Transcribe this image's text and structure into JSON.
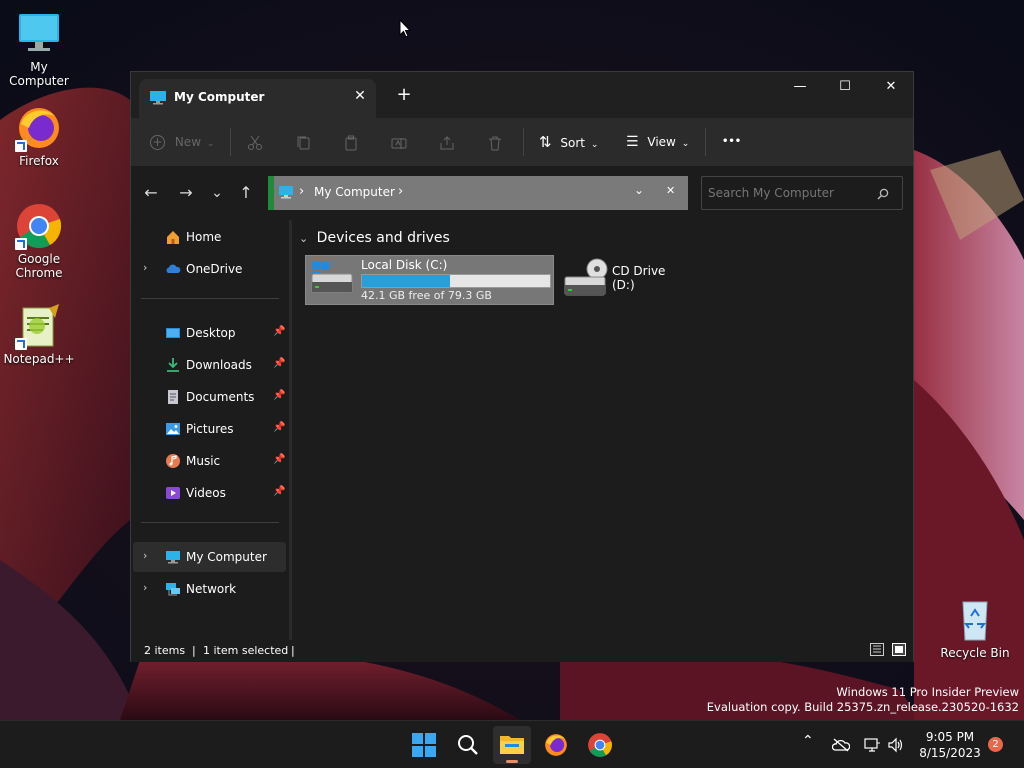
{
  "desktop": {
    "icons": [
      {
        "label": "My Computer"
      },
      {
        "label": "Firefox"
      },
      {
        "label": "Google Chrome"
      },
      {
        "label": "Notepad++"
      },
      {
        "label": "Recycle Bin"
      }
    ],
    "watermark": {
      "line1": "Windows 11 Pro Insider Preview",
      "line2": "Evaluation copy. Build 25375.zn_release.230520-1632"
    }
  },
  "window": {
    "tab_title": "My Computer",
    "tab_close_glyph": "✕",
    "new_tab_glyph": "+",
    "controls": {
      "minimize": "—",
      "maximize": "☐",
      "close": "✕"
    }
  },
  "toolbar": {
    "new_label": "New",
    "sort_label": "Sort",
    "view_label": "View",
    "more_glyph": "•••",
    "disabled_icons": [
      "cut-icon",
      "copy-icon",
      "paste-icon",
      "rename-icon",
      "share-icon",
      "delete-icon"
    ]
  },
  "navigation": {
    "back": "←",
    "forward": "→",
    "recent": "⌄",
    "up": "↑",
    "address": {
      "crumb_sep": "›",
      "location": "My Computer"
    },
    "search_placeholder": "Search My Computer"
  },
  "sidebar": {
    "top": [
      {
        "label": "Home",
        "icon": "home-icon"
      },
      {
        "label": "OneDrive",
        "icon": "cloud-icon"
      }
    ],
    "quick_access": [
      {
        "label": "Desktop",
        "icon": "desktop-icon"
      },
      {
        "label": "Downloads",
        "icon": "download-icon"
      },
      {
        "label": "Documents",
        "icon": "documents-icon"
      },
      {
        "label": "Pictures",
        "icon": "pictures-icon"
      },
      {
        "label": "Music",
        "icon": "music-icon"
      },
      {
        "label": "Videos",
        "icon": "videos-icon"
      }
    ],
    "bottom": [
      {
        "label": "My Computer",
        "icon": "computer-icon",
        "selected": true
      },
      {
        "label": "Network",
        "icon": "network-icon"
      }
    ]
  },
  "content": {
    "group_header": "Devices and drives",
    "drives": [
      {
        "name": "Local Disk (C:)",
        "free_text": "42.1 GB free of 79.3 GB",
        "used_fraction": 0.469,
        "selected": true
      },
      {
        "name": "CD Drive (D:)"
      }
    ]
  },
  "status": {
    "items": "2 items",
    "separator": "|",
    "selected": "1 item selected"
  },
  "taskbar": {
    "apps": [
      "start-icon",
      "search-icon",
      "file-explorer-icon",
      "firefox-icon",
      "chrome-icon"
    ],
    "clock_time": "9:05 PM",
    "clock_date": "8/15/2023",
    "notification_count": "2"
  },
  "colors": {
    "accent": "#26a0da",
    "window_bg": "#1c1c1c",
    "toolbar_bg": "#2b2b2b",
    "address_bg": "#7a7a7a",
    "selected_drive_bg": "#777777"
  }
}
